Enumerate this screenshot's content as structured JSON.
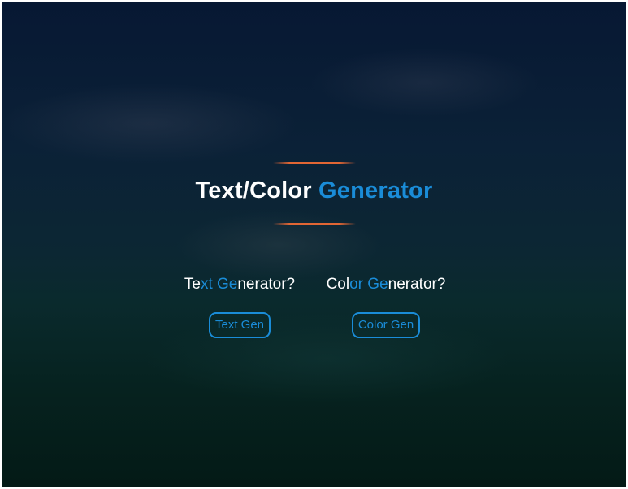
{
  "header": {
    "title_main": "Text/Color ",
    "title_accent": "Generator"
  },
  "text_generator": {
    "question_parts": [
      "Te",
      "xt",
      " ",
      "Ge",
      "nerator?"
    ],
    "button_label": "Text Gen"
  },
  "color_generator": {
    "question_parts": [
      "Col",
      "or",
      " ",
      "Ge",
      "nerator?"
    ],
    "button_label": "Color Gen"
  },
  "colors": {
    "accent": "#1a8cd8",
    "divider": "#e26634",
    "text": "#ffffff",
    "background_top": "#071833",
    "background_bottom": "#041a16"
  }
}
